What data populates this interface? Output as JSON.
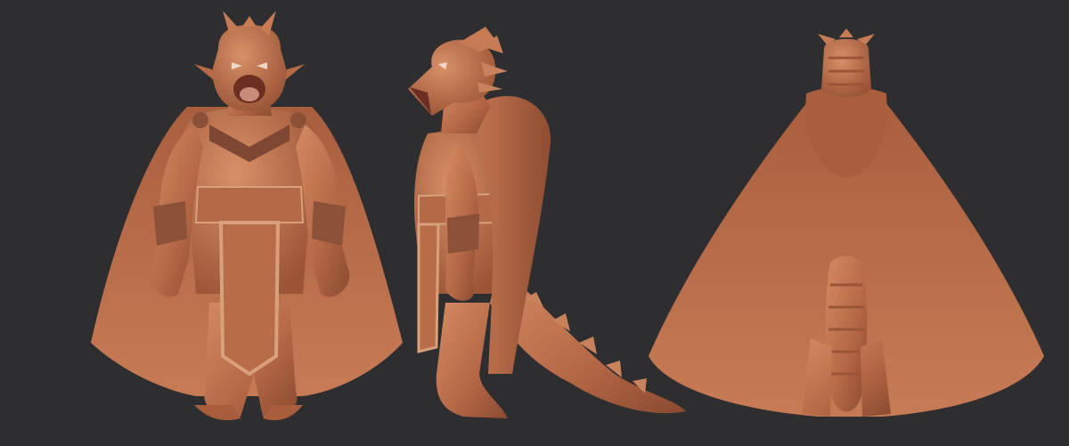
{
  "scene": {
    "background_color": "#2e2e30",
    "clay_base_color": "#b86a47",
    "clay_shadow_color": "#8a4a30",
    "clay_highlight_color": "#d48a63",
    "trim_color": "#d9a07c",
    "views": [
      {
        "view": "front",
        "subject": "dragon-character-front-view"
      },
      {
        "view": "side",
        "subject": "dragon-character-side-view"
      },
      {
        "view": "back",
        "subject": "dragon-character-back-view"
      }
    ]
  }
}
